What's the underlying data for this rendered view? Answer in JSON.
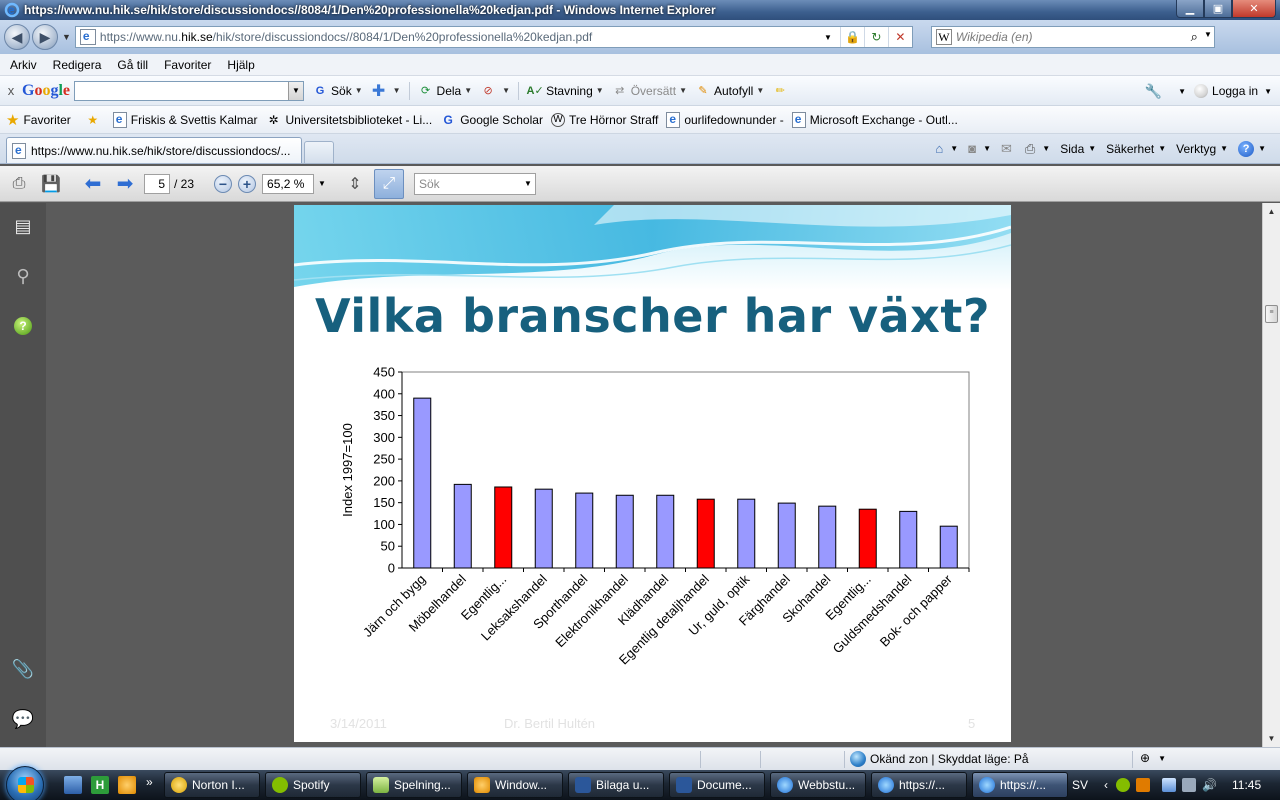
{
  "window": {
    "title": "https://www.nu.hik.se/hik/store/discussiondocs//8084/1/Den%20professionella%20kedjan.pdf - Windows Internet Explorer",
    "minimize": "▁",
    "maximize": "▣",
    "close": "✕"
  },
  "address": {
    "url_prefix": "https://www.nu.",
    "url_domain": "hik.se",
    "url_suffix": "/hik/store/discussiondocs//8084/1/Den%20professionella%20kedjan.pdf",
    "search_placeholder": "Wikipedia (en)",
    "search_engine_glyph": "W"
  },
  "menu": [
    "Arkiv",
    "Redigera",
    "Gå till",
    "Favoriter",
    "Hjälp"
  ],
  "google_toolbar": {
    "close": "x",
    "logo_parts": [
      "G",
      "o",
      "o",
      "g",
      "l",
      "e"
    ],
    "search_button": "Sök",
    "share": "Dela",
    "spelling": "Stavning",
    "translate": "Översätt",
    "autofill": "Autofyll",
    "login": "Logga in"
  },
  "favorites": {
    "label": "Favoriter",
    "items": [
      "Friskis & Svettis Kalmar",
      "Universitetsbiblioteket - Li...",
      "Google Scholar",
      "Tre Hörnor Straff",
      "ourlifedownunder -",
      "Microsoft Exchange - Outl..."
    ]
  },
  "tabs": {
    "active_title": "https://www.nu.hik.se/hik/store/discussiondocs/..."
  },
  "command_bar": {
    "page": "Sida",
    "safety": "Säkerhet",
    "tools": "Verktyg"
  },
  "pdf_toolbar": {
    "current_page": "5",
    "total_pages": "/ 23",
    "zoom": "65,2 %",
    "search_placeholder": "Sök"
  },
  "slide": {
    "title": "Vilka branscher har växt?",
    "footer_date": "3/14/2011",
    "footer_author": "Dr. Bertil Hultén",
    "footer_page": "5"
  },
  "chart_data": {
    "type": "bar",
    "ylabel": "Index 1997=100",
    "xlabel": "",
    "ylim": [
      0,
      450
    ],
    "yticks": [
      0,
      50,
      100,
      150,
      200,
      250,
      300,
      350,
      400,
      450
    ],
    "grid": false,
    "categories": [
      "Järn och bygg",
      "Möbelhandel",
      "Egentlig...",
      "Leksakshandel",
      "Sporthandel",
      "Elektronikhandel",
      "Klädhandel",
      "Egentlig detaljhandel",
      "Ur, guld, optik",
      "Färghandel",
      "Skohandel",
      "Egentlig...",
      "Guldsmedshandel",
      "Bok- och papper"
    ],
    "values": [
      390,
      192,
      186,
      181,
      172,
      167,
      167,
      158,
      158,
      149,
      142,
      135,
      130,
      96
    ],
    "colors": [
      "#9999ff",
      "#9999ff",
      "#ff0000",
      "#9999ff",
      "#9999ff",
      "#9999ff",
      "#9999ff",
      "#ff0000",
      "#9999ff",
      "#9999ff",
      "#9999ff",
      "#ff0000",
      "#9999ff",
      "#9999ff"
    ]
  },
  "status": {
    "zone": "Okänd zon | Skyddat läge: På",
    "zoom_glyph": "⊕"
  },
  "taskbar": {
    "tasks": [
      "Norton I...",
      "Spotify",
      "Spelning...",
      "Window...",
      "Bilaga u...",
      "Docume...",
      "Webbstu...",
      "https://...",
      "https://..."
    ],
    "overflow": "»",
    "language": "SV",
    "clock": "11:45"
  }
}
